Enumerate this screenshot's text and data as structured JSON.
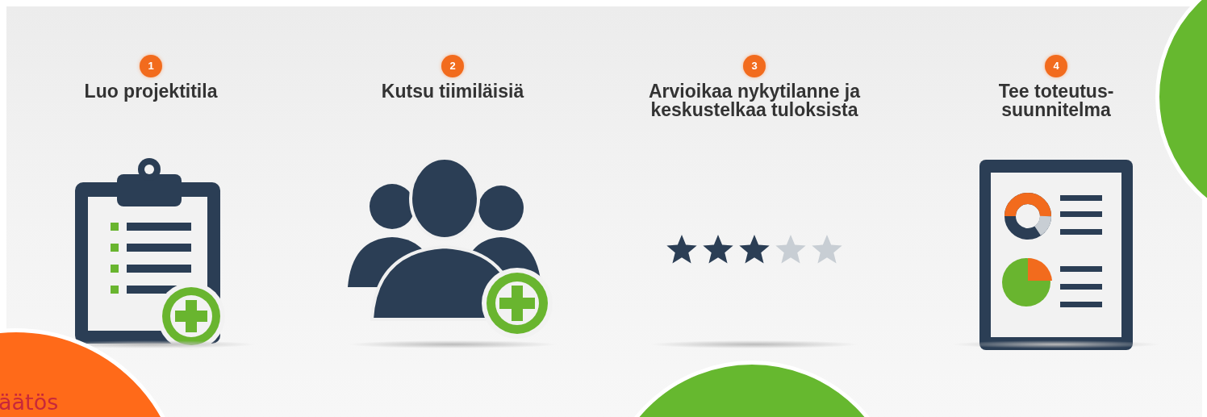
{
  "steps": [
    {
      "number": "1",
      "title": "Luo projektitila",
      "kind": "clipboard"
    },
    {
      "number": "2",
      "title": "Kutsu tiimiläisiä",
      "kind": "team"
    },
    {
      "number": "3",
      "title": "Arvioikaa nykytilanne ja\nkeskustelkaa tuloksista",
      "kind": "rating",
      "stars": 3
    },
    {
      "number": "4",
      "title": "Tee toteutus-\nsuunnitelma",
      "kind": "report"
    }
  ],
  "bubbles": [
    {
      "kind": "orange",
      "label": "äätös"
    },
    {
      "kind": "green-bottom"
    },
    {
      "kind": "green-right"
    }
  ]
}
